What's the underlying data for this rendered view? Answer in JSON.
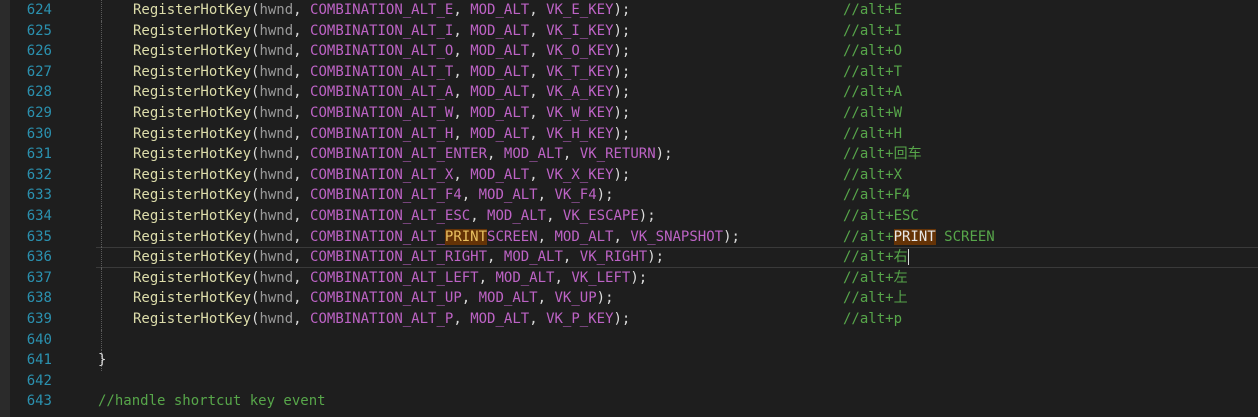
{
  "hotkey_lines": [
    {
      "ln": "624",
      "const": "COMBINATION_ALT_E",
      "vk": "VK_E_KEY",
      "comment": "//alt+E"
    },
    {
      "ln": "625",
      "const": "COMBINATION_ALT_I",
      "vk": "VK_I_KEY",
      "comment": "//alt+I"
    },
    {
      "ln": "626",
      "const": "COMBINATION_ALT_O",
      "vk": "VK_O_KEY",
      "comment": "//alt+O"
    },
    {
      "ln": "627",
      "const": "COMBINATION_ALT_T",
      "vk": "VK_T_KEY",
      "comment": "//alt+T"
    },
    {
      "ln": "628",
      "const": "COMBINATION_ALT_A",
      "vk": "VK_A_KEY",
      "comment": "//alt+A"
    },
    {
      "ln": "629",
      "const": "COMBINATION_ALT_W",
      "vk": "VK_W_KEY",
      "comment": "//alt+W"
    },
    {
      "ln": "630",
      "const": "COMBINATION_ALT_H",
      "vk": "VK_H_KEY",
      "comment": "//alt+H"
    },
    {
      "ln": "631",
      "const": "COMBINATION_ALT_ENTER",
      "vk": "VK_RETURN",
      "comment": "//alt+回车"
    },
    {
      "ln": "632",
      "const": "COMBINATION_ALT_X",
      "vk": "VK_X_KEY",
      "comment": "//alt+X"
    },
    {
      "ln": "633",
      "const": "COMBINATION_ALT_F4",
      "vk": "VK_F4",
      "comment": "//alt+F4"
    },
    {
      "ln": "634",
      "const": "COMBINATION_ALT_ESC",
      "vk": "VK_ESCAPE",
      "comment": "//alt+ESC"
    },
    {
      "ln": "635",
      "const_prefix": "COMBINATION_ALT_",
      "const_highlight": "PRINT",
      "const_suffix": "SCREEN",
      "vk": "VK_SNAPSHOT",
      "comment_prefix": "//alt+",
      "comment_highlight": "PRINT",
      "comment_suffix": " SCREEN"
    },
    {
      "ln": "636",
      "const": "COMBINATION_ALT_RIGHT",
      "vk": "VK_RIGHT",
      "comment": "//alt+右",
      "current": true
    },
    {
      "ln": "637",
      "const": "COMBINATION_ALT_LEFT",
      "vk": "VK_LEFT",
      "comment": "//alt+左"
    },
    {
      "ln": "638",
      "const": "COMBINATION_ALT_UP",
      "vk": "VK_UP",
      "comment": "//alt+上"
    },
    {
      "ln": "639",
      "const": "COMBINATION_ALT_P",
      "vk": "VK_P_KEY",
      "comment": "//alt+p"
    }
  ],
  "tokens": {
    "function": "RegisterHotKey",
    "open_paren": "(",
    "param": "hwnd",
    "comma": ", ",
    "modifier": "MOD_ALT",
    "close": ");"
  },
  "empty_line": {
    "ln": "640"
  },
  "brace_line": {
    "ln": "641",
    "text": "}"
  },
  "blank_line": {
    "ln": "642"
  },
  "comment_line": {
    "ln": "643",
    "text": "//handle shortcut key event"
  }
}
